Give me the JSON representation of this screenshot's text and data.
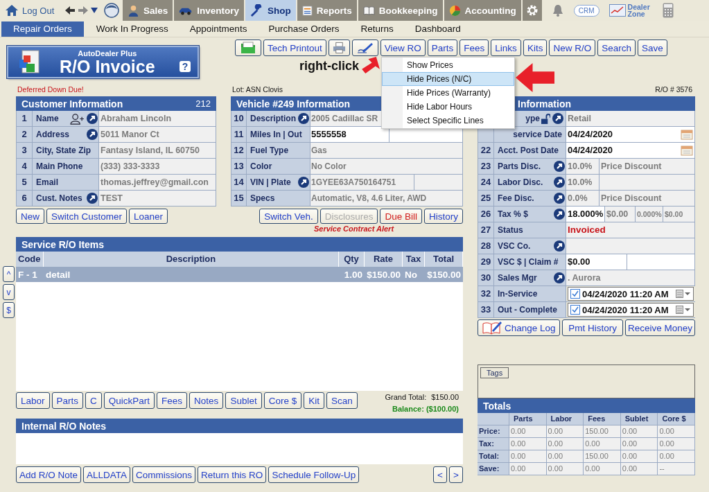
{
  "top_nav": {
    "logout": "Log Out",
    "tabs": [
      {
        "label": "Sales",
        "selected": false
      },
      {
        "label": "Inventory",
        "selected": false
      },
      {
        "label": "Shop",
        "selected": true
      },
      {
        "label": "Reports",
        "selected": false
      },
      {
        "label": "Bookkeeping",
        "selected": false
      },
      {
        "label": "Accounting",
        "selected": false
      }
    ],
    "crm": "CRM",
    "dealer_zone": "Dealer Zone"
  },
  "sub_nav": [
    {
      "label": "Repair Orders",
      "selected": true
    },
    {
      "label": "Work In Progress",
      "selected": false
    },
    {
      "label": "Appointments",
      "selected": false
    },
    {
      "label": "Purchase Orders",
      "selected": false
    },
    {
      "label": "Returns",
      "selected": false
    },
    {
      "label": "Dashboard",
      "selected": false
    }
  ],
  "logo": {
    "brand": "AutoDealer Plus",
    "title": "R/O Invoice",
    "help": "?"
  },
  "toolbar": [
    {
      "kind": "folder"
    },
    {
      "kind": "text",
      "label": "Tech Printout"
    },
    {
      "kind": "printer"
    },
    {
      "kind": "pen"
    },
    {
      "kind": "text",
      "label": "View RO"
    },
    {
      "kind": "text",
      "label": "Parts"
    },
    {
      "kind": "text",
      "label": "Fees"
    },
    {
      "kind": "text",
      "label": "Links"
    },
    {
      "kind": "text",
      "label": "Kits"
    },
    {
      "kind": "text",
      "label": "New R/O"
    },
    {
      "kind": "text",
      "label": "Search"
    },
    {
      "kind": "text",
      "label": "Save"
    }
  ],
  "annotation": "right-click",
  "context_menu": [
    {
      "label": "Show Prices",
      "selected": false
    },
    {
      "label": "Hide Prices (N/C)",
      "selected": true
    },
    {
      "label": "Hide Prices (Warranty)",
      "selected": false
    },
    {
      "label": "Hide Labor Hours",
      "selected": false
    },
    {
      "label": "Select Specific Lines",
      "selected": false
    }
  ],
  "notices": {
    "deferred": "Deferred Down Due!",
    "lot": "Lot: ASN Clovis",
    "ro_number": "R/O # 3576"
  },
  "customer": {
    "title": "Customer Information",
    "count": "212",
    "rows": [
      {
        "num": "1",
        "label": "Name",
        "link": true,
        "kind": "text",
        "cells": [
          {
            "text": "Abraham Lincoln",
            "editable": false
          }
        ]
      },
      {
        "num": "2",
        "label": "Address",
        "link": true,
        "kind": "text",
        "cells": [
          {
            "text": "5011 Manor Ct",
            "editable": false
          }
        ]
      },
      {
        "num": "3",
        "label": "City, State Zip",
        "link": false,
        "kind": "text",
        "cells": [
          {
            "text": "Fantasy Island, IL 60750",
            "editable": false
          }
        ]
      },
      {
        "num": "4",
        "label": "Main Phone",
        "link": false,
        "kind": "text",
        "cells": [
          {
            "text": "(333) 333-3333",
            "editable": false
          }
        ]
      },
      {
        "num": "5",
        "label": "Email",
        "link": false,
        "kind": "text",
        "cells": [
          {
            "text": "thomas.jeffrey@gmail.con",
            "editable": false
          }
        ]
      },
      {
        "num": "6",
        "label": "Cust. Notes",
        "link": true,
        "kind": "text",
        "cells": [
          {
            "text": "TEST",
            "editable": false
          }
        ]
      }
    ],
    "buttons": [
      "New",
      "Switch Customer",
      "Loaner"
    ]
  },
  "vehicle": {
    "title": "Vehicle #249 Information",
    "rows": [
      {
        "num": "10",
        "label": "Description",
        "link": true,
        "kind": "text",
        "cells": [
          {
            "text": "2005 Cadillac SR",
            "editable": false
          }
        ]
      },
      {
        "num": "11",
        "label": "Miles  In | Out",
        "link": false,
        "kind": "miles",
        "cells": [
          {
            "text": "5555558",
            "editable": true
          },
          {
            "editable": true
          }
        ]
      },
      {
        "num": "12",
        "label": "Fuel Type",
        "link": false,
        "kind": "text",
        "cells": [
          {
            "text": "Gas",
            "editable": false
          }
        ]
      },
      {
        "num": "13",
        "label": "Color",
        "link": false,
        "kind": "text",
        "cells": [
          {
            "text": "No Color",
            "editable": false
          }
        ]
      },
      {
        "num": "14",
        "label": "VIN | Plate",
        "link": true,
        "kind": "vin",
        "cells": [
          {
            "text": "1GYEE63A750164751",
            "editable": false
          },
          {
            "editable": false
          }
        ]
      },
      {
        "num": "15",
        "label": "Specs",
        "link": false,
        "kind": "text",
        "cells": [
          {
            "text": "Automatic, V8, 4.6 Liter, AWD",
            "editable": false
          }
        ]
      }
    ],
    "buttons": [
      {
        "label": "Switch Veh.",
        "kind": "plain"
      },
      {
        "label": "Disclosures",
        "kind": "disabled"
      },
      {
        "label": "Due Bill",
        "kind": "alert"
      },
      {
        "label": "History",
        "kind": "plain"
      }
    ],
    "alert": "Service Contract Alert"
  },
  "ro_info": {
    "title": "Information",
    "rows": [
      {
        "label": "ype",
        "link": true,
        "kind": "text",
        "cells": [
          {
            "text": "Retail",
            "editable": false
          }
        ]
      },
      {
        "label": "service Date",
        "link": false,
        "kind": "date",
        "cells": [
          {
            "text": "04/24/2020",
            "editable": true
          }
        ]
      },
      {
        "num": "22",
        "label": "Acct. Post Date",
        "link": false,
        "kind": "date",
        "cells": [
          {
            "text": "04/24/2020",
            "editable": true
          }
        ]
      },
      {
        "num": "23",
        "label": "Parts Disc.",
        "link": true,
        "kind": "discount",
        "cells": [
          {
            "text": "10.0%",
            "editable": false
          },
          {
            "text": "Price Discount",
            "editable": false
          }
        ]
      },
      {
        "num": "24",
        "label": "Labor Disc.",
        "link": true,
        "kind": "discount",
        "cells": [
          {
            "text": "10.0%",
            "editable": false
          },
          {
            "editable": false
          }
        ]
      },
      {
        "num": "25",
        "label": "Fee Disc.",
        "link": true,
        "kind": "discount",
        "cells": [
          {
            "text": "0.0%",
            "editable": false
          },
          {
            "text": "Price Discount",
            "editable": false
          }
        ]
      },
      {
        "num": "26",
        "label": "Tax % $",
        "link": true,
        "kind": "tax",
        "cells": [
          {
            "text": "18.000%",
            "editable": true
          },
          {
            "text": "$0.00",
            "editable": false
          },
          {
            "text": "0.000%",
            "editable": false
          },
          {
            "text": "$0.00",
            "editable": false
          }
        ]
      },
      {
        "num": "27",
        "label": "Status",
        "link": false,
        "kind": "status",
        "cells": [
          {
            "text": "Invoiced",
            "editable": false
          }
        ]
      },
      {
        "num": "28",
        "label": "VSC  Co.",
        "link": true,
        "kind": "text",
        "cells": [
          {
            "editable": false
          }
        ]
      },
      {
        "num": "29",
        "label": "VSC $ | Claim #",
        "link": false,
        "kind": "claim",
        "cells": [
          {
            "text": "$0.00",
            "editable": true
          },
          {
            "editable": true
          }
        ]
      },
      {
        "num": "30",
        "label": "Sales Mgr",
        "link": true,
        "kind": "text",
        "cells": [
          {
            "text": ". Aurora",
            "editable": false
          }
        ]
      },
      {
        "num": "32",
        "label": "In-Service",
        "link": false,
        "kind": "datetime",
        "cells": [
          {
            "text": "04/24/2020 11:20 AM",
            "checked": true
          }
        ]
      },
      {
        "num": "33",
        "label": "Out - Complete",
        "link": false,
        "kind": "datetime",
        "cells": [
          {
            "text": "04/24/2020 11:20 AM",
            "checked": true
          }
        ]
      }
    ],
    "buttons": [
      "Change Log",
      "Pmt History",
      "Receive Money"
    ]
  },
  "side_buttons": [
    "^",
    "v",
    "$"
  ],
  "service_items": {
    "title": "Service R/O Items",
    "columns": [
      "Code",
      "Description",
      "Qty",
      "Rate",
      "Tax",
      "Total"
    ],
    "rows": [
      {
        "code": "F - 1",
        "description": "detail",
        "qty": "1.00",
        "rate": "$150.00",
        "tax": "No",
        "total": "$150.00",
        "selected": true
      }
    ],
    "buttons": [
      "Labor",
      "Parts",
      "C",
      "QuickPart",
      "Fees",
      "Notes",
      "Sublet",
      "Core $",
      "Kit",
      "Scan"
    ],
    "grand_total_label": "Grand Total:",
    "grand_total": "$150.00",
    "balance": "Balance: ($100.00)"
  },
  "notes": {
    "title": "Internal R/O Notes",
    "buttons": [
      "Add R/O Note",
      "ALLDATA",
      "Commissions",
      "Return this RO",
      "Schedule Follow-Up"
    ],
    "pager": [
      "<",
      ">"
    ]
  },
  "tags": {
    "button": "Tags"
  },
  "totals": {
    "title": "Totals",
    "columns": [
      "Parts",
      "Labor",
      "Fees",
      "Sublet",
      "Core $"
    ],
    "rows": [
      {
        "label": "Price:",
        "values": [
          "0.00",
          "0.00",
          "150.00",
          "0.00",
          "0.00"
        ]
      },
      {
        "label": "Tax:",
        "values": [
          "0.00",
          "0.00",
          "0.00",
          "0.00",
          "0.00"
        ]
      },
      {
        "label": "Total:",
        "values": [
          "0.00",
          "0.00",
          "150.00",
          "0.00",
          "0.00"
        ]
      },
      {
        "label": "Save:",
        "values": [
          "0.00",
          "0.00",
          "0.00",
          "0.00",
          "--"
        ]
      }
    ]
  }
}
